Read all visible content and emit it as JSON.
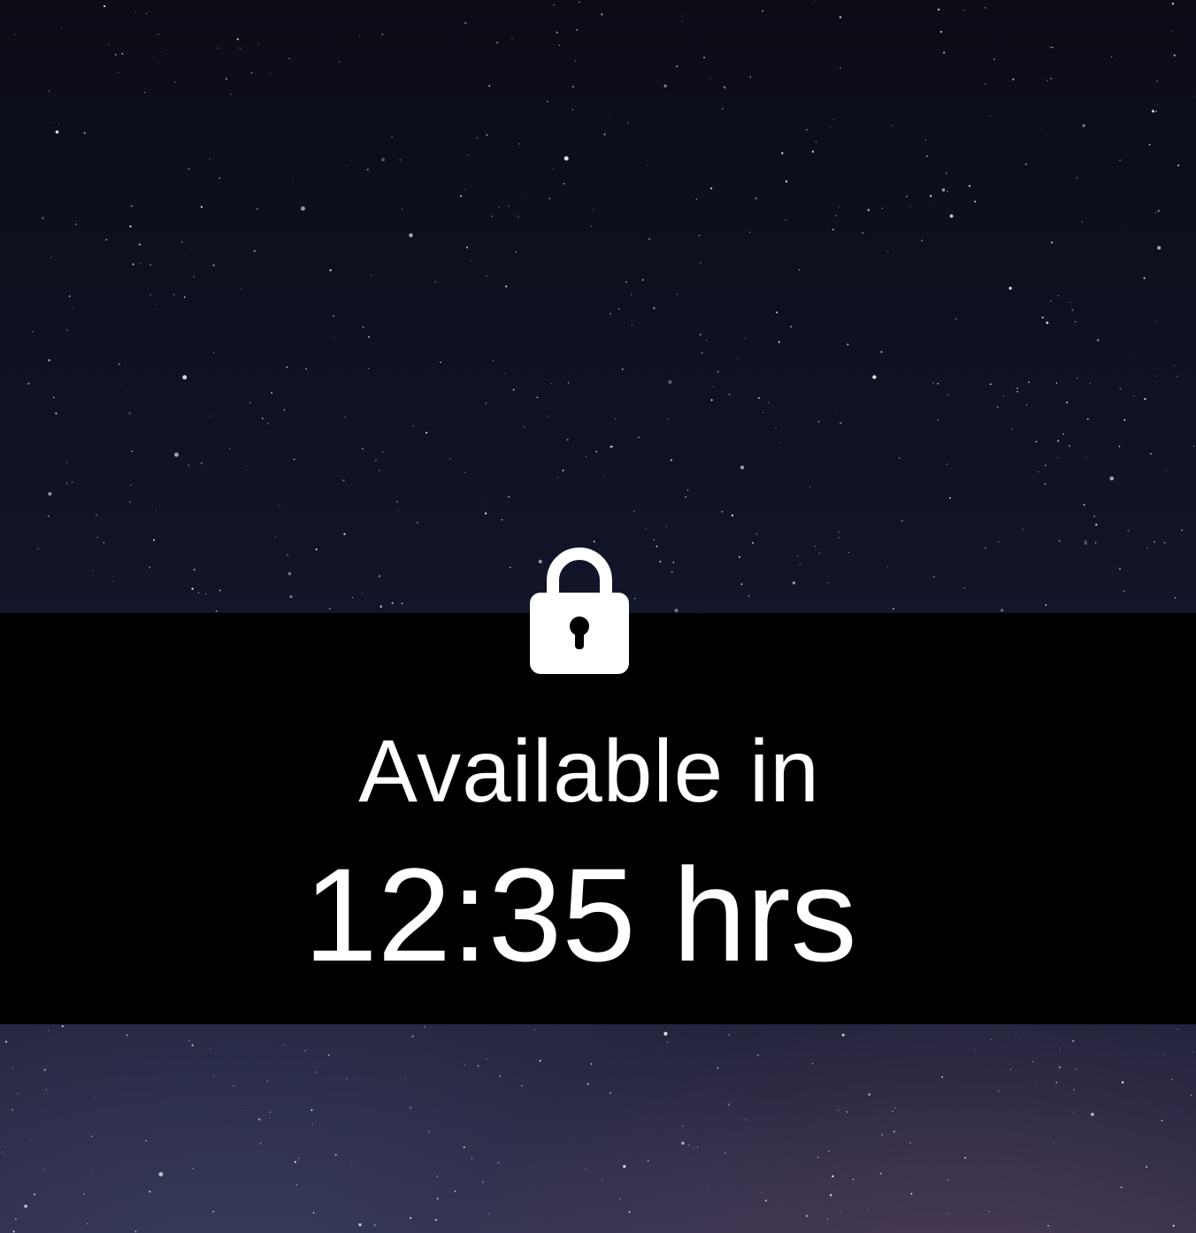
{
  "lock_screen": {
    "icon": "lock-icon",
    "status_label": "Available in",
    "time_remaining": "12:35 hrs"
  },
  "colors": {
    "banner": "#000000",
    "text": "#ffffff",
    "sky_top": "#0b0c16",
    "sky_bottom": "#2c2a44"
  }
}
